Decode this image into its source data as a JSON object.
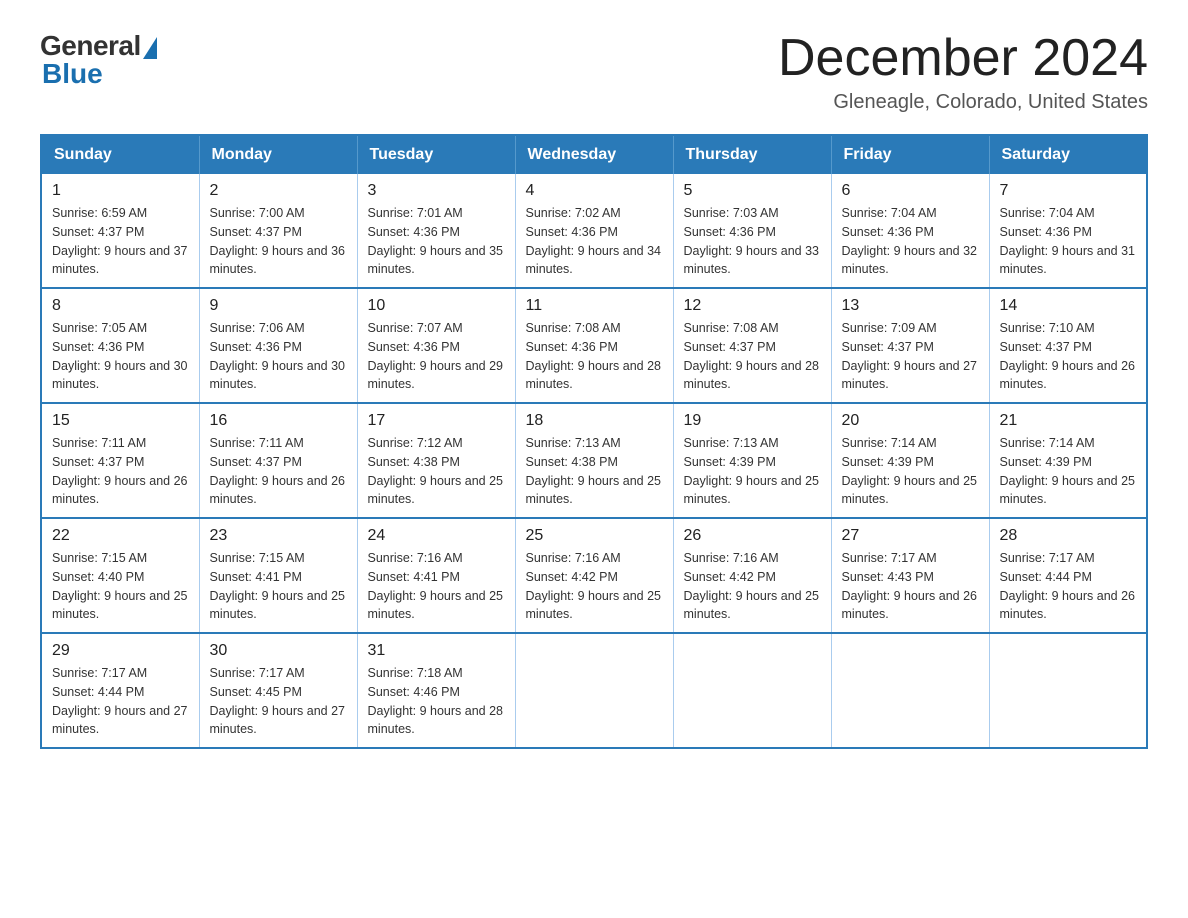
{
  "header": {
    "logo_general": "General",
    "logo_blue": "Blue",
    "title": "December 2024",
    "location": "Gleneagle, Colorado, United States"
  },
  "calendar": {
    "days_of_week": [
      "Sunday",
      "Monday",
      "Tuesday",
      "Wednesday",
      "Thursday",
      "Friday",
      "Saturday"
    ],
    "weeks": [
      [
        {
          "day": "1",
          "sunrise": "6:59 AM",
          "sunset": "4:37 PM",
          "daylight": "9 hours and 37 minutes."
        },
        {
          "day": "2",
          "sunrise": "7:00 AM",
          "sunset": "4:37 PM",
          "daylight": "9 hours and 36 minutes."
        },
        {
          "day": "3",
          "sunrise": "7:01 AM",
          "sunset": "4:36 PM",
          "daylight": "9 hours and 35 minutes."
        },
        {
          "day": "4",
          "sunrise": "7:02 AM",
          "sunset": "4:36 PM",
          "daylight": "9 hours and 34 minutes."
        },
        {
          "day": "5",
          "sunrise": "7:03 AM",
          "sunset": "4:36 PM",
          "daylight": "9 hours and 33 minutes."
        },
        {
          "day": "6",
          "sunrise": "7:04 AM",
          "sunset": "4:36 PM",
          "daylight": "9 hours and 32 minutes."
        },
        {
          "day": "7",
          "sunrise": "7:04 AM",
          "sunset": "4:36 PM",
          "daylight": "9 hours and 31 minutes."
        }
      ],
      [
        {
          "day": "8",
          "sunrise": "7:05 AM",
          "sunset": "4:36 PM",
          "daylight": "9 hours and 30 minutes."
        },
        {
          "day": "9",
          "sunrise": "7:06 AM",
          "sunset": "4:36 PM",
          "daylight": "9 hours and 30 minutes."
        },
        {
          "day": "10",
          "sunrise": "7:07 AM",
          "sunset": "4:36 PM",
          "daylight": "9 hours and 29 minutes."
        },
        {
          "day": "11",
          "sunrise": "7:08 AM",
          "sunset": "4:36 PM",
          "daylight": "9 hours and 28 minutes."
        },
        {
          "day": "12",
          "sunrise": "7:08 AM",
          "sunset": "4:37 PM",
          "daylight": "9 hours and 28 minutes."
        },
        {
          "day": "13",
          "sunrise": "7:09 AM",
          "sunset": "4:37 PM",
          "daylight": "9 hours and 27 minutes."
        },
        {
          "day": "14",
          "sunrise": "7:10 AM",
          "sunset": "4:37 PM",
          "daylight": "9 hours and 26 minutes."
        }
      ],
      [
        {
          "day": "15",
          "sunrise": "7:11 AM",
          "sunset": "4:37 PM",
          "daylight": "9 hours and 26 minutes."
        },
        {
          "day": "16",
          "sunrise": "7:11 AM",
          "sunset": "4:37 PM",
          "daylight": "9 hours and 26 minutes."
        },
        {
          "day": "17",
          "sunrise": "7:12 AM",
          "sunset": "4:38 PM",
          "daylight": "9 hours and 25 minutes."
        },
        {
          "day": "18",
          "sunrise": "7:13 AM",
          "sunset": "4:38 PM",
          "daylight": "9 hours and 25 minutes."
        },
        {
          "day": "19",
          "sunrise": "7:13 AM",
          "sunset": "4:39 PM",
          "daylight": "9 hours and 25 minutes."
        },
        {
          "day": "20",
          "sunrise": "7:14 AM",
          "sunset": "4:39 PM",
          "daylight": "9 hours and 25 minutes."
        },
        {
          "day": "21",
          "sunrise": "7:14 AM",
          "sunset": "4:39 PM",
          "daylight": "9 hours and 25 minutes."
        }
      ],
      [
        {
          "day": "22",
          "sunrise": "7:15 AM",
          "sunset": "4:40 PM",
          "daylight": "9 hours and 25 minutes."
        },
        {
          "day": "23",
          "sunrise": "7:15 AM",
          "sunset": "4:41 PM",
          "daylight": "9 hours and 25 minutes."
        },
        {
          "day": "24",
          "sunrise": "7:16 AM",
          "sunset": "4:41 PM",
          "daylight": "9 hours and 25 minutes."
        },
        {
          "day": "25",
          "sunrise": "7:16 AM",
          "sunset": "4:42 PM",
          "daylight": "9 hours and 25 minutes."
        },
        {
          "day": "26",
          "sunrise": "7:16 AM",
          "sunset": "4:42 PM",
          "daylight": "9 hours and 25 minutes."
        },
        {
          "day": "27",
          "sunrise": "7:17 AM",
          "sunset": "4:43 PM",
          "daylight": "9 hours and 26 minutes."
        },
        {
          "day": "28",
          "sunrise": "7:17 AM",
          "sunset": "4:44 PM",
          "daylight": "9 hours and 26 minutes."
        }
      ],
      [
        {
          "day": "29",
          "sunrise": "7:17 AM",
          "sunset": "4:44 PM",
          "daylight": "9 hours and 27 minutes."
        },
        {
          "day": "30",
          "sunrise": "7:17 AM",
          "sunset": "4:45 PM",
          "daylight": "9 hours and 27 minutes."
        },
        {
          "day": "31",
          "sunrise": "7:18 AM",
          "sunset": "4:46 PM",
          "daylight": "9 hours and 28 minutes."
        },
        null,
        null,
        null,
        null
      ]
    ]
  }
}
